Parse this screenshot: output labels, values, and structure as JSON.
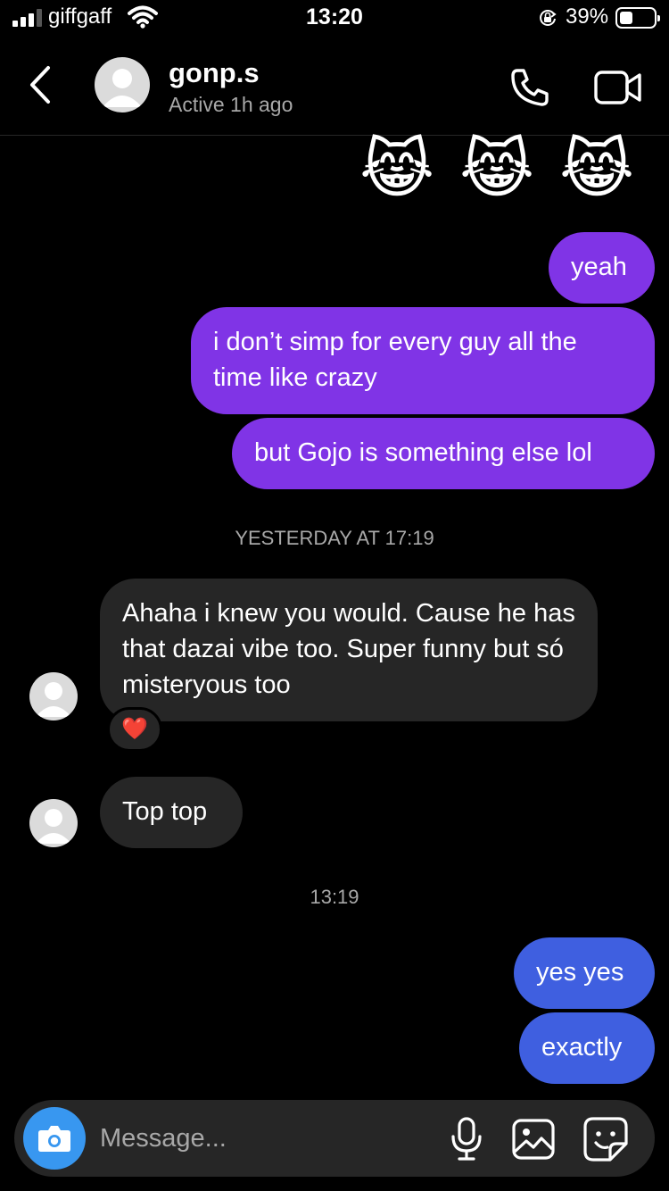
{
  "status_bar": {
    "carrier": "giffgaff",
    "time": "13:20",
    "battery_percent": "39%",
    "battery_level": 0.39
  },
  "header": {
    "contact_name": "gonp.s",
    "contact_status": "Active 1h ago",
    "icons": [
      "chevron-left-icon",
      "avatar",
      "phone-icon",
      "video-camera-icon"
    ]
  },
  "chat": {
    "emojis": [
      "😹",
      "😹",
      "😹"
    ],
    "messages_sent_1": [
      "yeah",
      "i don’t simp for every guy all the time like crazy",
      "but Gojo is something else lol"
    ],
    "timestamp_1": "YESTERDAY AT 17:19",
    "messages_received": [
      "Ahaha i knew you would. Cause he has that dazai vibe too. Super funny but só misteryous too",
      "Top top"
    ],
    "reaction": "❤️",
    "timestamp_2": "13:19",
    "messages_sent_2": [
      "yes yes",
      "exactly"
    ]
  },
  "composer": {
    "placeholder": "Message...",
    "icons": [
      "camera-icon",
      "microphone-icon",
      "gallery-icon",
      "sticker-icon"
    ]
  },
  "colors": {
    "background": "#000000",
    "sent_purple": "#8034e6",
    "sent_blue": "#3f5fe0",
    "received": "#262626",
    "camera_button": "#3897f0"
  }
}
